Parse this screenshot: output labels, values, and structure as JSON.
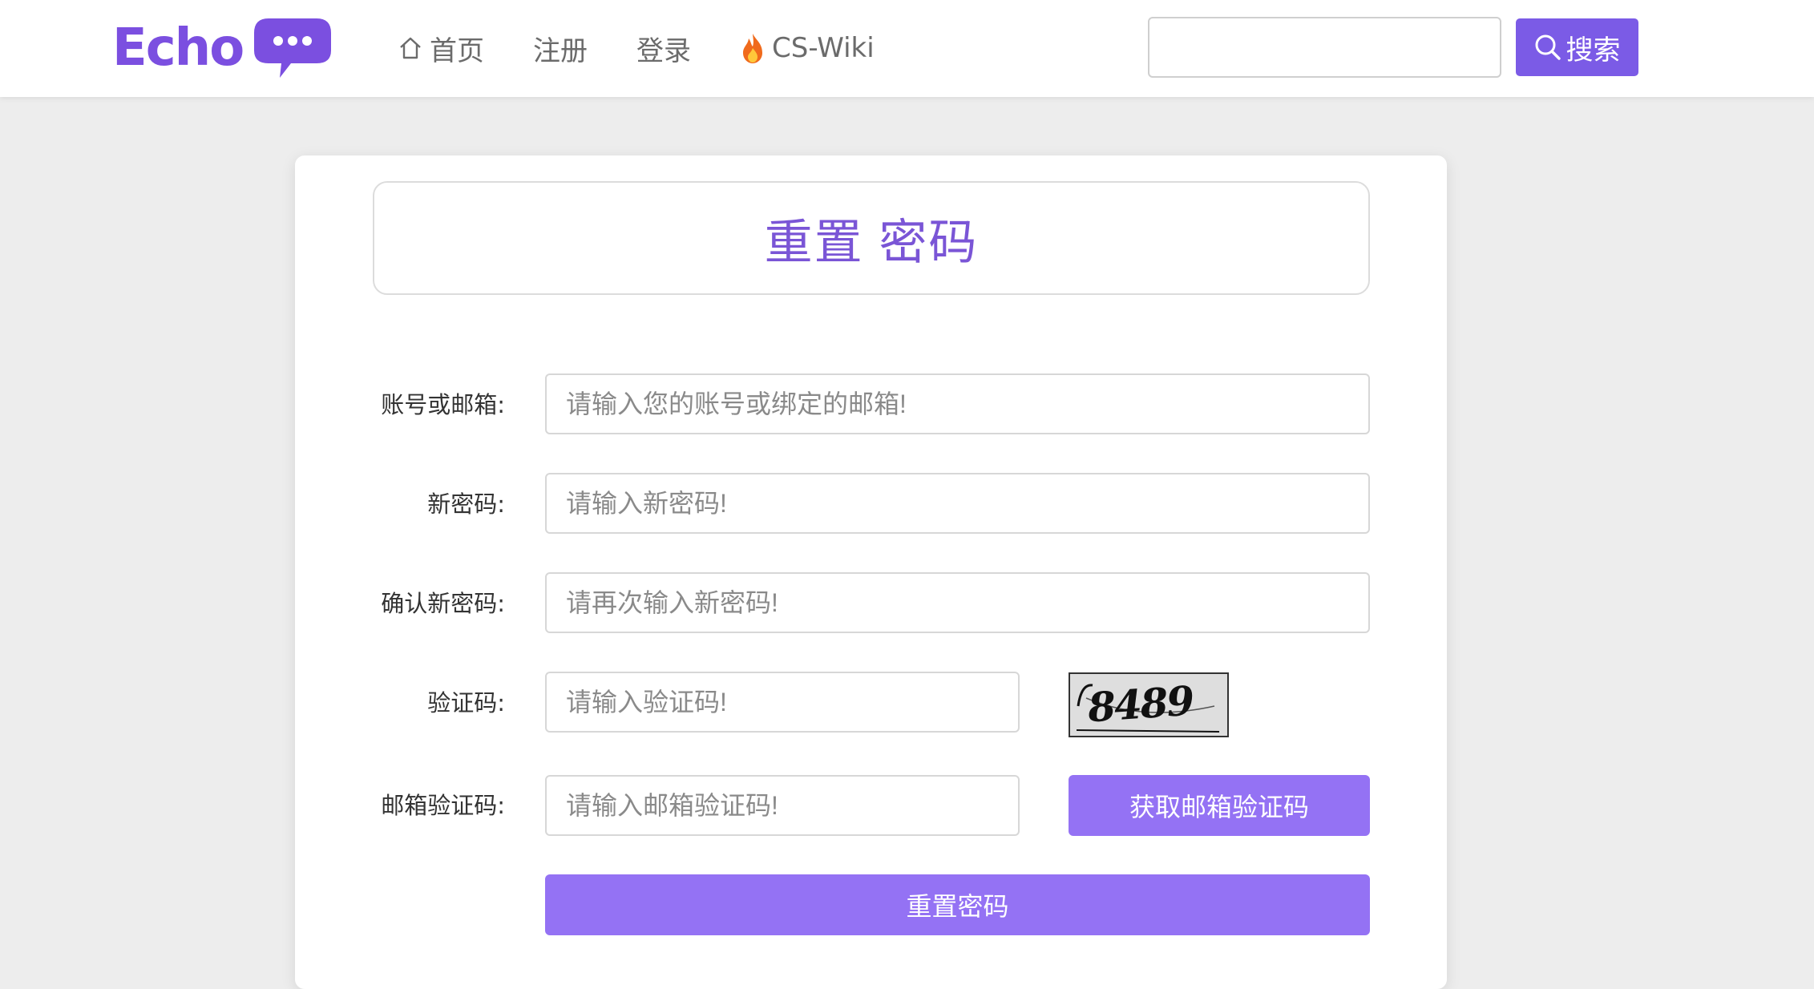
{
  "header": {
    "logo_text": "Echo",
    "nav": {
      "home": "首页",
      "register": "注册",
      "login": "登录",
      "wiki": "CS-Wiki"
    },
    "search": {
      "placeholder": "",
      "button_label": "搜索"
    }
  },
  "form": {
    "title": "重置 密码",
    "account": {
      "label": "账号或邮箱:",
      "placeholder": "请输入您的账号或绑定的邮箱!"
    },
    "new_password": {
      "label": "新密码:",
      "placeholder": "请输入新密码!"
    },
    "confirm_password": {
      "label": "确认新密码:",
      "placeholder": "请再次输入新密码!"
    },
    "captcha": {
      "label": "验证码:",
      "placeholder": "请输入验证码!",
      "image_text": "8489"
    },
    "email_code": {
      "label": "邮箱验证码:",
      "placeholder": "请输入邮箱验证码!",
      "button_label": "获取邮箱验证码"
    },
    "submit_label": "重置密码"
  },
  "colors": {
    "brand": "#7b4fe0",
    "button": "#9472f4",
    "search_button": "#7b5be6",
    "background": "#ededed"
  },
  "icons": {
    "home": "home-icon",
    "wiki": "fire-icon",
    "search": "search-icon",
    "logo": "chat-bubble-icon"
  }
}
